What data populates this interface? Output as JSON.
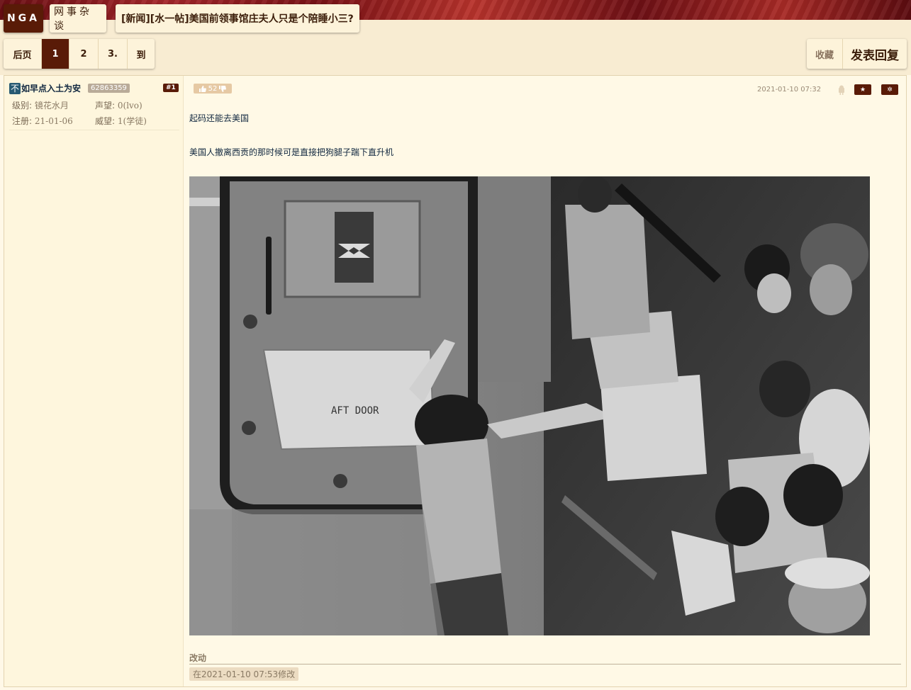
{
  "header": {
    "logo": "NGA",
    "forum_name": "网事杂谈",
    "topic_title": "[新闻][水一帖]美国前领事馆庄夫人只是个陪睡小三?"
  },
  "pager": {
    "items": [
      {
        "label": "后页",
        "current": false
      },
      {
        "label": "1",
        "current": true
      },
      {
        "label": "2",
        "current": false
      },
      {
        "label": "3.",
        "current": false
      },
      {
        "label": "到",
        "current": false
      }
    ]
  },
  "actions": {
    "favorite": "收藏",
    "reply": "发表回复"
  },
  "post": {
    "user": {
      "avatar_char": "不",
      "name": "如早点入土为安",
      "uid": "62863359",
      "level_label": "级别:",
      "level": "镜花水月",
      "reputation_label": "声望:",
      "reputation": "0(lvo)",
      "registered_label": "注册:",
      "registered": "21-01-06",
      "prestige_label": "威望:",
      "prestige": "1(学徒)"
    },
    "floor": "#1",
    "likes": "52",
    "date": "2021-01-10 07:32",
    "lines": [
      "起码还能去美国",
      "美国人撤离西贡的那时候可是直接把狗腿子踹下直升机"
    ],
    "photo_door_text": "AFT DOOR",
    "edit_label": "改动",
    "edit_time": "在2021-01-10 07:53修改"
  },
  "colors": {
    "accent": "#591b07",
    "page_bg": "#fff8e7",
    "header_bg": "#f8ecd2"
  }
}
